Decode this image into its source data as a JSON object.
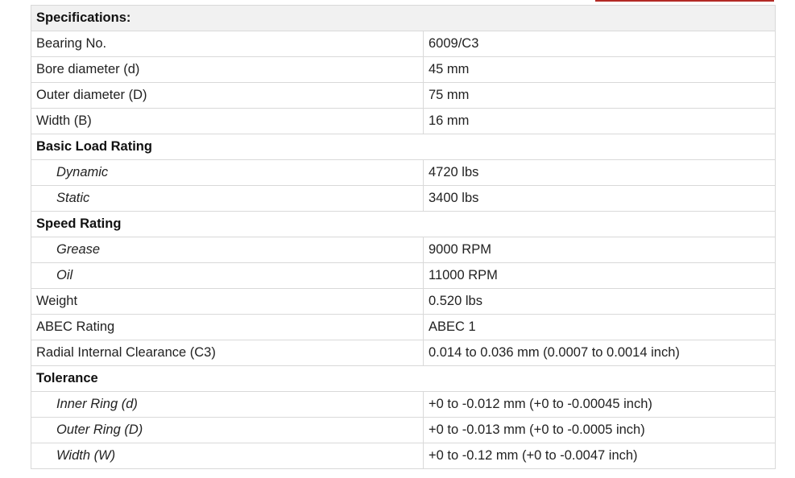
{
  "colors": {
    "accent": "#b32a25",
    "header_bg": "#f1f1f1",
    "border": "#d9d9d9"
  },
  "specs": {
    "header": "Specifications:",
    "rows": [
      {
        "label": "Bearing No.",
        "value": "6009/C3"
      },
      {
        "label": "Bore diameter (d)",
        "value": "45 mm"
      },
      {
        "label": "Outer diameter (D)",
        "value": "75 mm"
      },
      {
        "label": "Width (B)",
        "value": "16 mm"
      }
    ],
    "load_rating": {
      "title": "Basic Load Rating",
      "rows": [
        {
          "label": "Dynamic",
          "value": "4720 lbs"
        },
        {
          "label": "Static",
          "value": "3400 lbs"
        }
      ]
    },
    "speed_rating": {
      "title": "Speed Rating",
      "rows": [
        {
          "label": "Grease",
          "value": "9000 RPM"
        },
        {
          "label": "Oil",
          "value": "11000 RPM"
        }
      ]
    },
    "misc_rows": [
      {
        "label": "Weight",
        "value": "0.520 lbs"
      },
      {
        "label": "ABEC Rating",
        "value": "ABEC 1"
      },
      {
        "label": "Radial Internal Clearance (C3)",
        "value": "0.014 to 0.036 mm (0.0007 to 0.0014 inch)"
      }
    ],
    "tolerance": {
      "title": "Tolerance",
      "rows": [
        {
          "label": "Inner Ring (d)",
          "value": "+0 to -0.012 mm (+0 to -0.00045 inch)"
        },
        {
          "label": "Outer Ring (D)",
          "value": "+0 to -0.013 mm (+0 to -0.0005 inch)"
        },
        {
          "label": "Width (W)",
          "value": "+0 to -0.12 mm (+0 to -0.0047 inch)"
        }
      ]
    }
  }
}
